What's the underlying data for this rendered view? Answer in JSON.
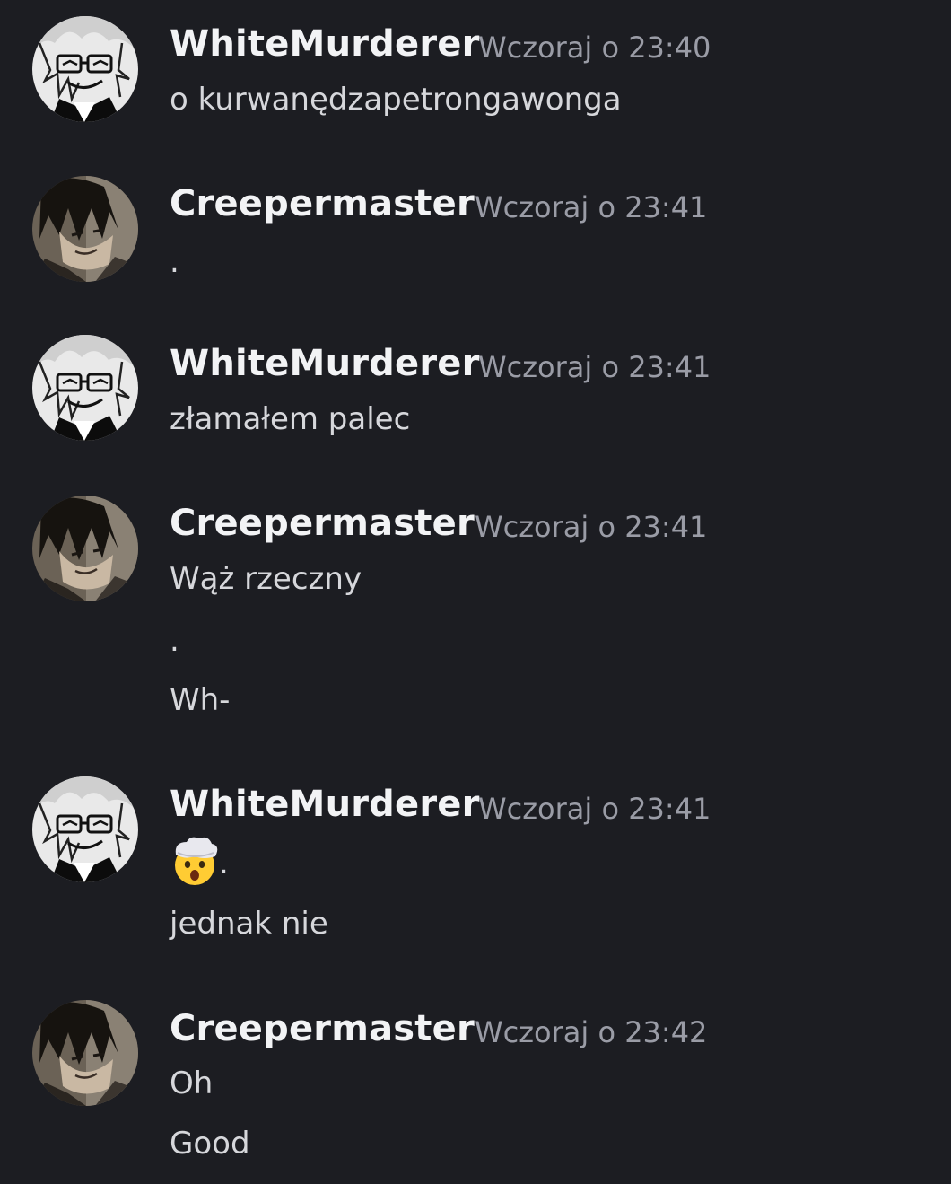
{
  "chat": {
    "groups": [
      {
        "author": "WhiteMurderer",
        "avatar_icon": "white-murderer-avatar-icon",
        "timestamp": "Wczoraj o 23:40",
        "messages": [
          "o kurwanędzapetrongawonga"
        ]
      },
      {
        "author": "Creepermaster",
        "avatar_icon": "creepermaster-avatar-icon",
        "timestamp": "Wczoraj o 23:41",
        "messages": [
          "."
        ]
      },
      {
        "author": "WhiteMurderer",
        "avatar_icon": "white-murderer-avatar-icon",
        "timestamp": "Wczoraj o 23:41",
        "messages": [
          "złamałem palec"
        ]
      },
      {
        "author": "Creepermaster",
        "avatar_icon": "creepermaster-avatar-icon",
        "timestamp": "Wczoraj o 23:41",
        "messages": [
          "Wąż rzeczny",
          ".",
          "Wh-"
        ]
      },
      {
        "author": "WhiteMurderer",
        "avatar_icon": "white-murderer-avatar-icon",
        "timestamp": "Wczoraj o 23:41",
        "emoji_icon": "exploding-head-emoji-icon",
        "messages": [
          ".",
          "jednak nie"
        ]
      },
      {
        "author": "Creepermaster",
        "avatar_icon": "creepermaster-avatar-icon",
        "timestamp": "Wczoraj o 23:42",
        "messages": [
          "Oh",
          "Good"
        ]
      }
    ]
  },
  "colors": {
    "background": "#1c1d22",
    "author": "#f2f3f5",
    "timestamp": "#9a9ca6",
    "message": "#d6d7db"
  }
}
